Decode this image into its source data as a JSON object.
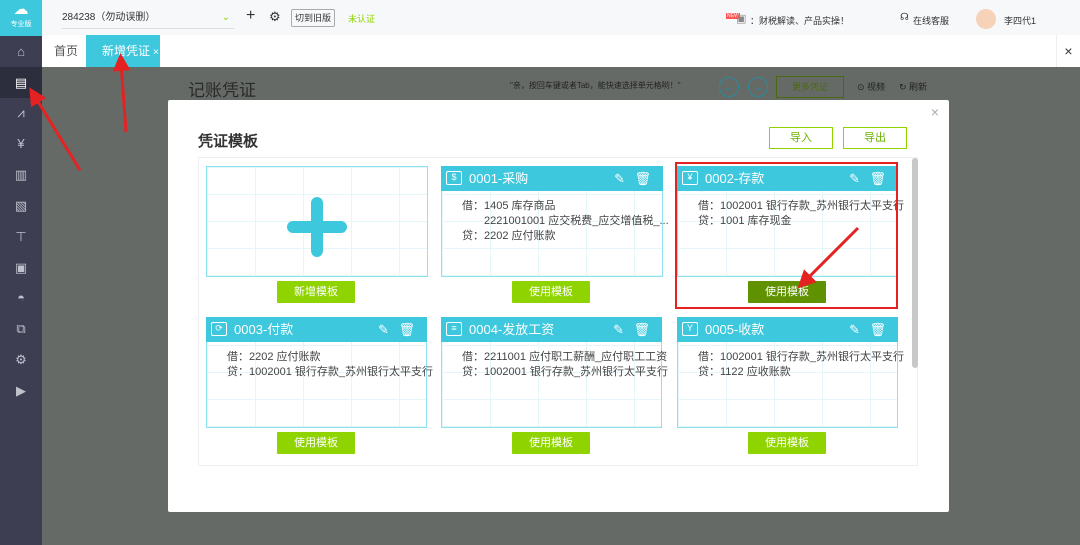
{
  "sidebar": {
    "logo_label": "专业版",
    "items": [
      "home-icon",
      "voucher-icon",
      "chart-icon",
      "money-bag-icon",
      "ledger-icon",
      "report-icon",
      "invoice-icon",
      "assets-icon",
      "salary-icon",
      "export-icon",
      "settings-icon",
      "video-icon"
    ],
    "active_index": 1
  },
  "topbar": {
    "account": "284238（勿动误删）",
    "switch_label": "切到旧版",
    "auth_status": "未认证",
    "promo_badge": "NEW",
    "promo_text": "：财税解读、产品实操！",
    "service_label": "在线客服",
    "user_name": "李四代1"
  },
  "tabs": [
    {
      "label": "首页"
    },
    {
      "label": "新增凭证",
      "closable": true
    }
  ],
  "page": {
    "title": "记账凭证",
    "hint": "\"亲，按回车键或者Tab，能快速选择单元格哟！\"",
    "more_label": "更多凭证",
    "video_label": "视频",
    "refresh_label": "刷新"
  },
  "modal": {
    "title": "凭证模板",
    "import_label": "导入",
    "export_label": "导出",
    "add_label": "新增模板",
    "templates": [
      {
        "name": "0001-采购",
        "icon": "purchase-icon",
        "lines": [
          "借：1405 库存商品",
          "　　2221001001 应交税费_应交增值税_...",
          "贷：2202 应付账款"
        ],
        "button": "使用模板"
      },
      {
        "name": "0002-存款",
        "icon": "deposit-icon",
        "lines": [
          "借：1002001 银行存款_苏州银行太平支行",
          "贷：1001 库存现金"
        ],
        "button": "使用模板",
        "highlighted": true
      },
      {
        "name": "0003-付款",
        "icon": "payment-icon",
        "lines": [
          "借：2202 应付账款",
          "贷：1002001 银行存款_苏州银行太平支行"
        ],
        "button": "使用模板"
      },
      {
        "name": "0004-发放工资",
        "icon": "salary-icon",
        "lines": [
          "借：2211001 应付职工薪酬_应付职工工资",
          "贷：1002001 银行存款_苏州银行太平支行"
        ],
        "button": "使用模板"
      },
      {
        "name": "0005-收款",
        "icon": "receipt-icon",
        "lines": [
          "借：1002001 银行存款_苏州银行太平支行",
          "贷：1122 应收账款"
        ],
        "button": "使用模板"
      }
    ]
  },
  "colors": {
    "accent": "#3ec8de",
    "green": "#8fd400",
    "green_active": "#5f9100",
    "sidebar": "#3d3e52",
    "highlight": "#e52222"
  }
}
